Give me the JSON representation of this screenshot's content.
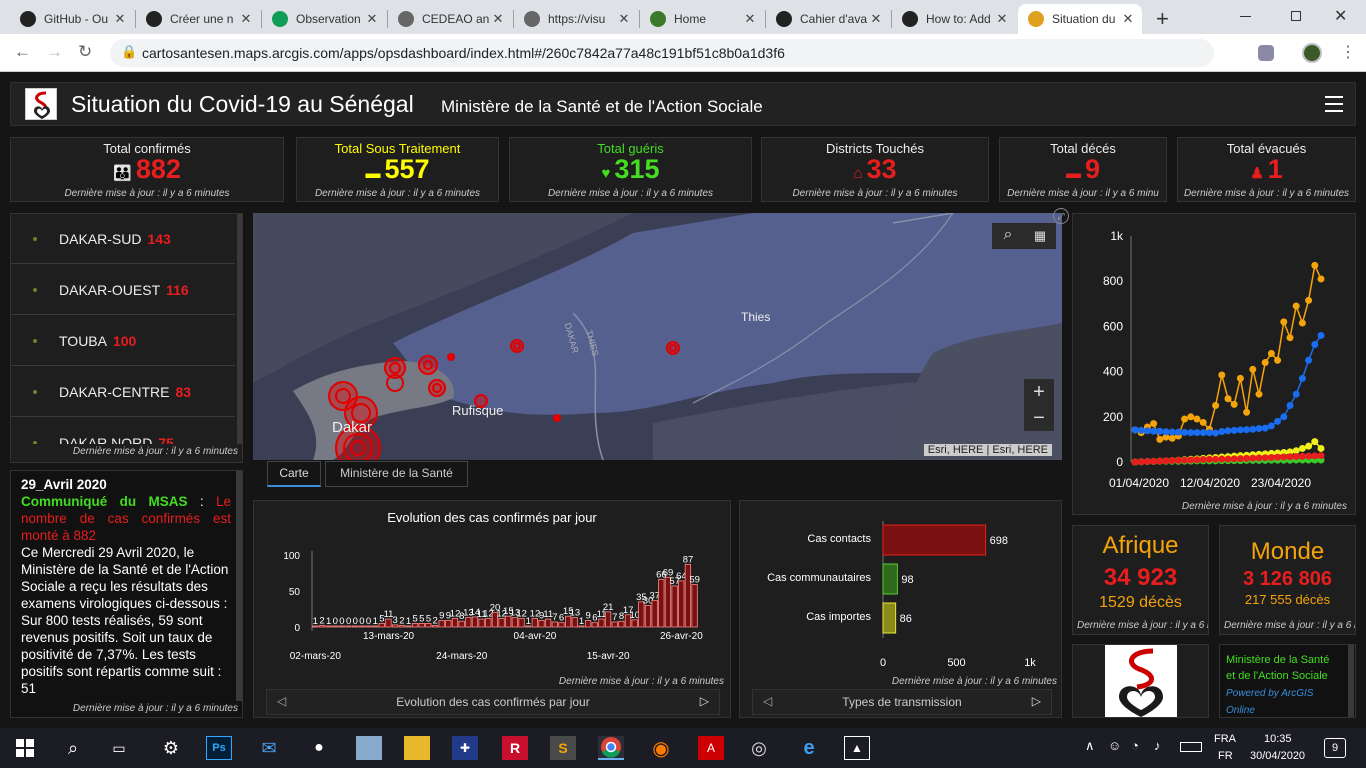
{
  "browser": {
    "tabs": [
      {
        "title": "GitHub - Ou",
        "icon": "github-icon"
      },
      {
        "title": "Créer une n",
        "icon": "github-icon"
      },
      {
        "title": "Observation",
        "icon": "sheets-icon"
      },
      {
        "title": "CEDEAO an",
        "icon": "globe-icon"
      },
      {
        "title": "https://visu",
        "icon": "globe-icon"
      },
      {
        "title": "Home",
        "icon": "emblem-icon"
      },
      {
        "title": "Cahier d'ava",
        "icon": "github-icon"
      },
      {
        "title": "How to: Add",
        "icon": "github-icon"
      },
      {
        "title": "Situation du",
        "icon": "arcgis-icon",
        "active": true
      }
    ],
    "new_tab": "+",
    "url": "cartosantesen.maps.arcgis.com/apps/opsdashboard/index.html#/260c7842a77a48c191bf51c8b0a1d3f6"
  },
  "header": {
    "title": "Situation du Covid-19 au Sénégal",
    "subtitle": "Ministère de la Santé et de l'Action Sociale"
  },
  "indicators": [
    {
      "label": "Total confirmés",
      "value": "882",
      "color": "#e81e1e",
      "label_color": "#eeeeee",
      "icon": "people-icon"
    },
    {
      "label": "Total Sous Traitement",
      "value": "557",
      "color": "#ffff00",
      "label_color": "#ffff00",
      "icon": "bed-icon"
    },
    {
      "label": "Total guéris",
      "value": "315",
      "color": "#44dd22",
      "label_color": "#44dd22",
      "icon": "heart-hand-icon"
    },
    {
      "label": "Districts Touchés",
      "value": "33",
      "color": "#e81e1e",
      "label_color": "#eeeeee",
      "icon": "house-icon"
    },
    {
      "label": "Total décés",
      "value": "9",
      "color": "#e81e1e",
      "label_color": "#eeeeee",
      "icon": "bed-icon"
    },
    {
      "label": "Total évacués",
      "value": "1",
      "color": "#e81e1e",
      "label_color": "#eeeeee",
      "icon": "person-icon"
    }
  ],
  "last_update": "Dernière mise à jour : il y a 6 minutes",
  "last_update_trunc": "Dernière mise à jour : il y a 6 minu",
  "districts": [
    {
      "name": "DAKAR-SUD",
      "count": "143"
    },
    {
      "name": "DAKAR-OUEST",
      "count": "116"
    },
    {
      "name": "TOUBA",
      "count": "100"
    },
    {
      "name": "DAKAR-CENTRE",
      "count": "83"
    },
    {
      "name": "DAKAR NORD",
      "count": "75"
    }
  ],
  "news": {
    "date": "29_Avril 2020",
    "headline_label": "Communiqué du MSAS",
    "headline_sep": " : ",
    "headline_text": "Le nombre de cas confirmés est monté à 882",
    "body": "Ce Mercredi 29 Avril 2020, le Ministère de la Santé et de l'Action Sociale a reçu les résultats des examens virologiques ci-dessous : Sur 800 tests réalisés, 59 sont revenus positifs. Soit un taux de positivité de 7,37%. Les tests positifs sont répartis comme suit : 51"
  },
  "map": {
    "labels": {
      "thies": "Thies",
      "rufisque": "Rufisque",
      "dakar": "Dakar",
      "road1": "DAKAR",
      "road2": "THIES"
    },
    "attribution": "Esri, HERE | Esri, HERE",
    "zoom_in": "+",
    "zoom_out": "−",
    "tabs": [
      "Carte",
      "Ministère de la Santé"
    ]
  },
  "daily_chart": {
    "title": "Evolution des cas confirmés par jour",
    "nav_label": "Evolution des cas confirmés par jour"
  },
  "transmission_chart": {
    "nav_label": "Types de transmission"
  },
  "trend_chart": {},
  "afrique": {
    "title": "Afrique",
    "cases": "34 923",
    "deaths": "1529 décès"
  },
  "monde": {
    "title": "Monde",
    "cases": "3 126 806",
    "deaths": "217 555 décès"
  },
  "ministry_link": {
    "line1": "Ministère de la Santé",
    "line2": "et de l'Action Sociale",
    "powered": "Powered by ArcGIS",
    "online": "Online"
  },
  "taskbar": {
    "lang1": "FRA",
    "lang2": "FR",
    "time": "10:35",
    "date": "30/04/2020",
    "notif": "9"
  },
  "chart_data": [
    {
      "type": "bar",
      "title": "Evolution des cas confirmés par jour",
      "xlabel": "",
      "ylabel": "",
      "ylim": [
        0,
        100
      ],
      "yticks": [
        0,
        50,
        100
      ],
      "xticks": [
        "02-mars-20",
        "13-mars-20",
        "24-mars-20",
        "04-avr-20",
        "15-avr-20",
        "26-avr-20"
      ],
      "xtick_index": [
        0,
        11,
        22,
        33,
        44,
        55
      ],
      "values": [
        1,
        2,
        1,
        0,
        0,
        0,
        0,
        0,
        0,
        1,
        5,
        11,
        3,
        2,
        1,
        5,
        5,
        5,
        2,
        9,
        9,
        12,
        8,
        13,
        14,
        11,
        12,
        20,
        12,
        15,
        13,
        12,
        1,
        12,
        9,
        11,
        7,
        6,
        15,
        13,
        1,
        9,
        6,
        11,
        21,
        7,
        8,
        17,
        10,
        35,
        30,
        37,
        66,
        69,
        57,
        64,
        87,
        59
      ],
      "data_labels": [
        1,
        2,
        1,
        0,
        0,
        0,
        0,
        0,
        0,
        1,
        5,
        11,
        3,
        2,
        1,
        5,
        5,
        5,
        2,
        9,
        9,
        12,
        8,
        13,
        14,
        11,
        12,
        20,
        12,
        15,
        13,
        12,
        1,
        12,
        9,
        11,
        7,
        6,
        15,
        13,
        1,
        9,
        6,
        11,
        21,
        7,
        8,
        17,
        10,
        35,
        30,
        37,
        66,
        69,
        57,
        64,
        87,
        59
      ],
      "grid": false,
      "color": "#ff8a8a"
    },
    {
      "type": "bar",
      "orientation": "horizontal",
      "categories": [
        "Cas contacts",
        "Cas communautaires",
        "Cas importes"
      ],
      "values": [
        698,
        98,
        86
      ],
      "colors": [
        "#7a1010",
        "#2e6b1a",
        "#8a8a1a"
      ],
      "border_colors": [
        "#e81e1e",
        "#55cc33",
        "#e8e83a"
      ],
      "xlim": [
        0,
        1000
      ],
      "xticks": [
        "0",
        "500",
        "1k"
      ],
      "xlabel": "",
      "grid": false
    },
    {
      "type": "line",
      "xticks": [
        "01/04/2020",
        "12/04/2020",
        "23/04/2020"
      ],
      "ylim": [
        0,
        1000
      ],
      "yticks": [
        "0",
        "200",
        "400",
        "600",
        "800",
        "1k"
      ],
      "series": [
        {
          "color": "#f5a30a",
          "values": [
            142,
            130,
            155,
            170,
            100,
            110,
            105,
            115,
            190,
            200,
            190,
            175,
            145,
            250,
            385,
            280,
            255,
            370,
            220,
            410,
            300,
            440,
            480,
            450,
            620,
            550,
            690,
            615,
            715,
            870,
            810
          ]
        },
        {
          "color": "#1a6cf0",
          "values": [
            142,
            140,
            138,
            136,
            136,
            134,
            133,
            132,
            131,
            130,
            130,
            130,
            130,
            128,
            135,
            138,
            140,
            142,
            143,
            145,
            148,
            150,
            160,
            180,
            200,
            250,
            300,
            370,
            450,
            520,
            560
          ]
        },
        {
          "color": "#f0f01a",
          "values": [
            0,
            1,
            2,
            3,
            4,
            5,
            6,
            8,
            10,
            12,
            14,
            16,
            18,
            20,
            22,
            24,
            26,
            28,
            30,
            32,
            34,
            36,
            38,
            40,
            42,
            45,
            50,
            60,
            70,
            90,
            60
          ]
        },
        {
          "color": "#3acc2a",
          "values": [
            0,
            1,
            2,
            2,
            3,
            3,
            3,
            3,
            4,
            4,
            5,
            5,
            5,
            5,
            6,
            6,
            6,
            6,
            7,
            7,
            7,
            7,
            8,
            8,
            8,
            8,
            9,
            9,
            9,
            9,
            9
          ]
        },
        {
          "color": "#e81e1e",
          "values": [
            0,
            1,
            2,
            3,
            4,
            5,
            6,
            7,
            8,
            9,
            10,
            11,
            12,
            12,
            13,
            13,
            14,
            15,
            16,
            17,
            18,
            19,
            20,
            21,
            22,
            23,
            24,
            25,
            26,
            27,
            28
          ]
        }
      ],
      "grid": false
    }
  ]
}
